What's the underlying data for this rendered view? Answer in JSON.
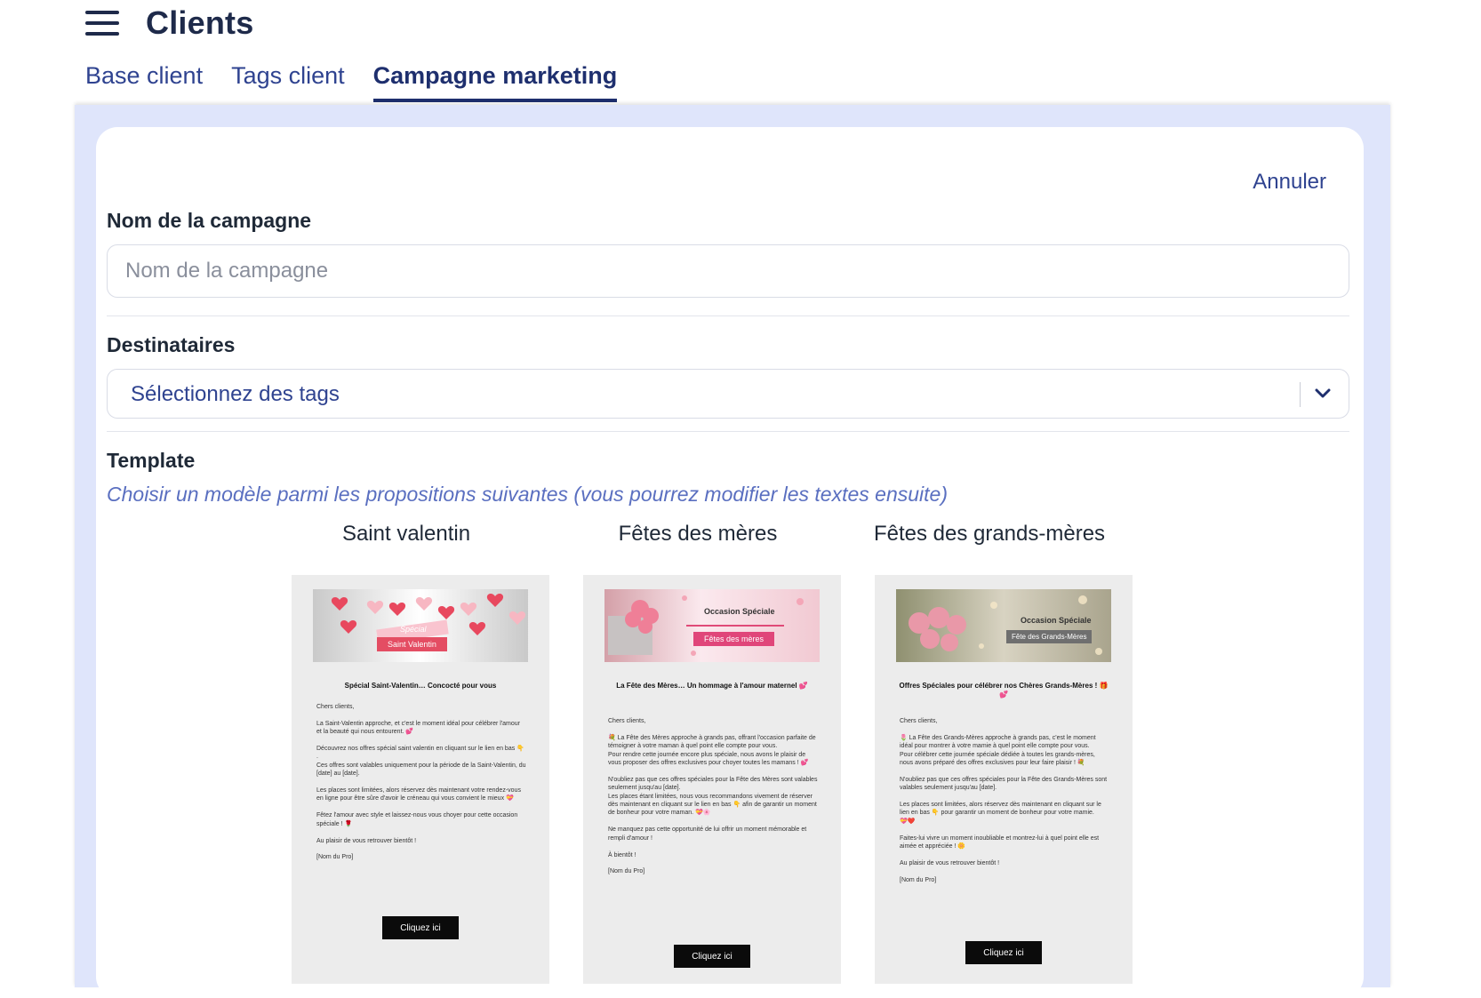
{
  "header": {
    "title": "Clients"
  },
  "tabs": [
    {
      "label": "Base client"
    },
    {
      "label": "Tags client"
    },
    {
      "label": "Campagne marketing"
    }
  ],
  "form": {
    "cancel_label": "Annuler",
    "name_label": "Nom de la campagne",
    "name_placeholder": "Nom de la campagne",
    "name_value": "",
    "recipients_label": "Destinataires",
    "recipients_placeholder": "Sélectionnez des tags",
    "template_label": "Template",
    "template_hint": "Choisir un modèle parmi les propositions suivantes (vous pourrez modifier les textes ensuite)"
  },
  "templates": [
    {
      "title": "Saint valentin",
      "banner_tag": "Spécial",
      "banner_label": "Saint Valentin",
      "heading": "Spécial Saint-Valentin… Concocté pour vous",
      "body": "Chers clients,\n\nLa Saint-Valentin approche, et c'est le moment idéal pour célébrer l'amour et la beauté qui nous entourent. 💕\n\nDécouvrez nos offres spécial saint valentin en cliquant sur le lien en bas 👇 .\nCes offres sont valables uniquement pour la période de la Saint-Valentin, du [date] au [date].\n\nLes places sont limitées, alors réservez dès maintenant votre rendez-vous en ligne pour être sûre d'avoir le créneau qui vous convient le mieux 💝\n\nFêtez l'amour avec style et laissez-nous vous choyer pour cette occasion spéciale ! 🌹\n\nAu plaisir de vous retrouver bientôt !\n\n[Nom du Pro]",
      "button": "Cliquez ici"
    },
    {
      "title": "Fêtes des mères",
      "banner_tag": "Occasion Spéciale",
      "banner_label": "Fêtes des mères",
      "heading": "La Fête des Mères… Un hommage à l'amour maternel 💕",
      "body": "Chers clients,\n\n💐 La Fête des Mères approche à grands pas, offrant l'occasion parfaite de témoigner à votre maman à quel point elle compte pour vous.\nPour rendre cette journée encore plus spéciale, nous avons le plaisir de vous proposer des offres exclusives pour choyer toutes les mamans ! 💕\n\nN'oubliez pas que ces offres spéciales pour la Fête des Mères sont valables seulement jusqu'au [date].\nLes places étant limitées, nous vous recommandons vivement de réserver dès maintenant en cliquant sur le lien en bas 👇 afin de garantir un moment de bonheur pour votre maman. 💝🌸\n\nNe manquez pas cette opportunité de lui offrir un moment mémorable et rempli d'amour !\n\nÀ bientôt !\n\n[Nom du Pro]",
      "button": "Cliquez ici"
    },
    {
      "title": "Fêtes des grands-mères",
      "banner_tag": "Occasion Spéciale",
      "banner_label": "Fête des Grands-Mères",
      "heading": "Offres Spéciales pour célébrer nos Chères Grands-Mères ! 🎁💕",
      "body": "Chers clients,\n\n🌷 La Fête des Grands-Mères approche à grands pas, c'est le moment idéal pour montrer à votre mamie à quel point elle compte pour vous.\nPour célébrer cette journée spéciale dédiée à toutes les grands-mères, nous avons préparé des offres exclusives pour leur faire plaisir ! 💐\n\nN'oubliez pas que ces offres spéciales pour la Fête des Grands-Mères sont valables seulement jusqu'au [date].\n\nLes places sont limitées, alors réservez dès maintenant en cliquant sur le lien en bas 👇 pour garantir un moment de bonheur pour votre mamie.\n💝❤️\n\nFaites-lui vivre un moment inoubliable et montrez-lui à quel point elle est aimée et appréciée ! 🌼\n\nAu plaisir de vous retrouver bientôt !\n\n[Nom du Pro]",
      "button": "Cliquez ici"
    }
  ],
  "colors": {
    "accent": "#2f4390",
    "panel": "#dfe5fb",
    "hint": "#5a6fc0",
    "valentine": "#e44d63"
  }
}
